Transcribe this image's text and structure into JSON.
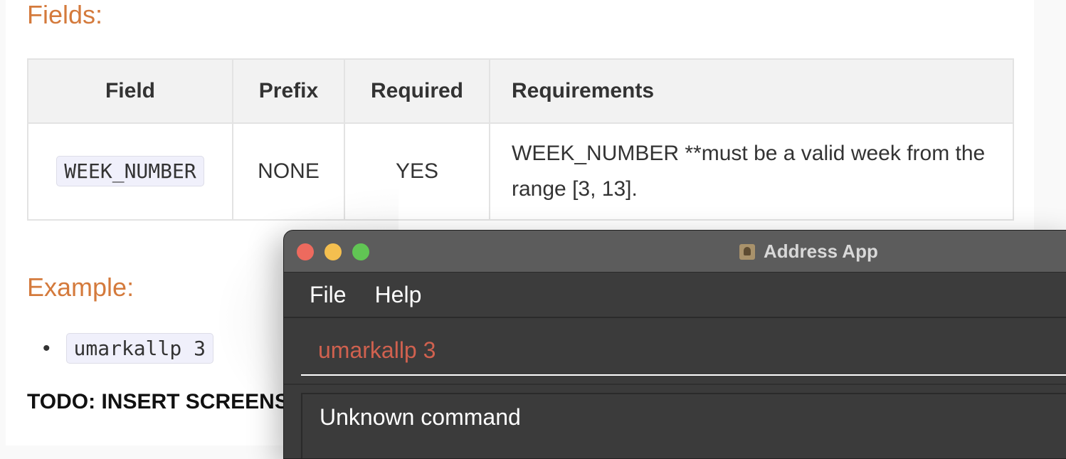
{
  "doc": {
    "fields_heading": "Fields:",
    "table": {
      "headers": [
        "Field",
        "Prefix",
        "Required",
        "Requirements"
      ],
      "rows": [
        {
          "field": "WEEK_NUMBER",
          "prefix": "NONE",
          "required": "YES",
          "requirements": "WEEK_NUMBER **must be a valid week from the range [3, 13]."
        }
      ]
    },
    "example_heading": "Example:",
    "example_items": [
      "umarkallp 3"
    ],
    "todo": "TODO: INSERT SCREENSHOT"
  },
  "app": {
    "title": "Address App",
    "menu": [
      "File",
      "Help"
    ],
    "command_value": "umarkallp 3",
    "result_text": "Unknown command",
    "colors": {
      "command_text": "#d0614f",
      "titlebar": "#5c5c5c",
      "background": "#3b3b3b"
    }
  }
}
